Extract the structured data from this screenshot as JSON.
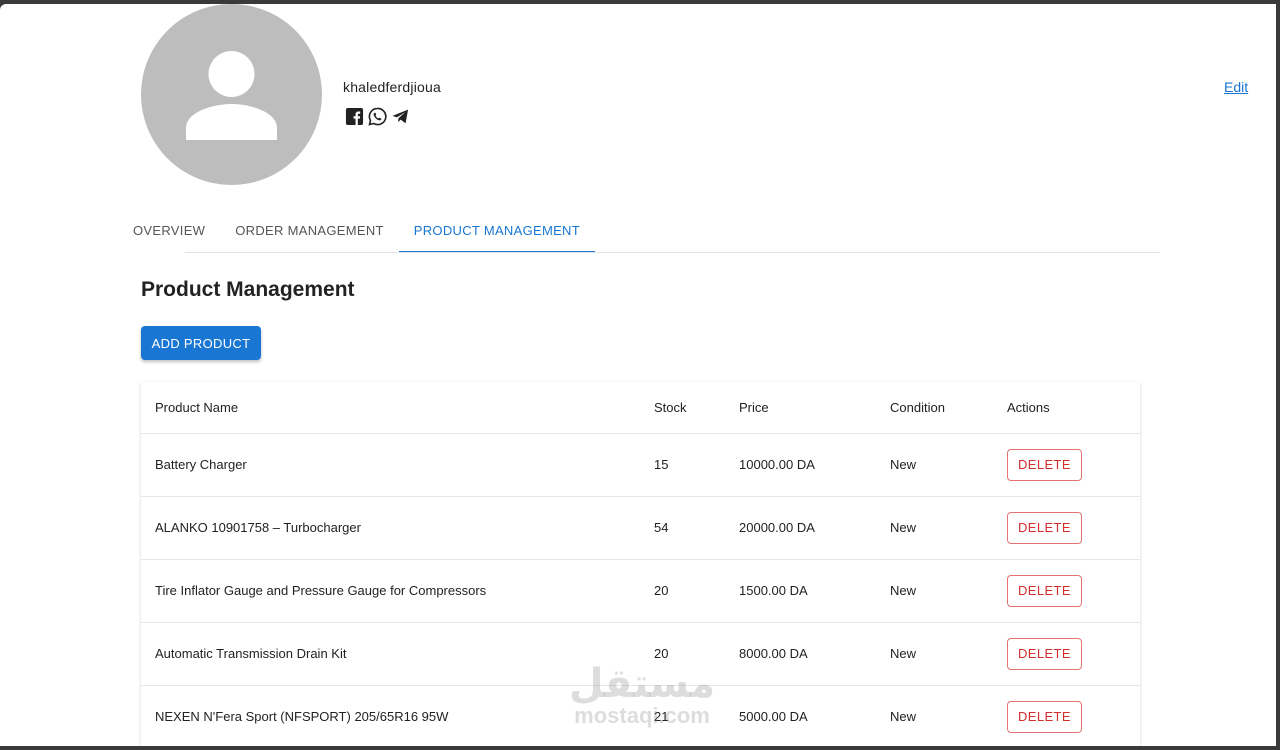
{
  "profile": {
    "username": "khaledferdjioua",
    "avatar_icon": "user-silhouette-icon",
    "socials": [
      {
        "name": "facebook-icon"
      },
      {
        "name": "whatsapp-icon"
      },
      {
        "name": "telegram-icon"
      }
    ],
    "edit_label": "Edit"
  },
  "tabs": [
    {
      "label": "OVERVIEW",
      "active": false
    },
    {
      "label": "ORDER MANAGEMENT",
      "active": false
    },
    {
      "label": "PRODUCT MANAGEMENT",
      "active": true
    }
  ],
  "section": {
    "title": "Product Management",
    "add_button_label": "ADD PRODUCT"
  },
  "table": {
    "headers": [
      "Product Name",
      "Stock",
      "Price",
      "Condition",
      "Actions"
    ],
    "delete_label": "DELETE",
    "rows": [
      {
        "name": "Battery Charger",
        "stock": "15",
        "price": "10000.00 DA",
        "condition": "New"
      },
      {
        "name": "ALANKO 10901758 – Turbocharger",
        "stock": "54",
        "price": "20000.00 DA",
        "condition": "New"
      },
      {
        "name": "Tire Inflator Gauge and Pressure Gauge for Compressors",
        "stock": "20",
        "price": "1500.00 DA",
        "condition": "New"
      },
      {
        "name": "Automatic Transmission Drain Kit",
        "stock": "20",
        "price": "8000.00 DA",
        "condition": "New"
      },
      {
        "name": "NEXEN N'Fera Sport (NFSPORT) 205/65R16 95W",
        "stock": "21",
        "price": "5000.00 DA",
        "condition": "New"
      }
    ]
  },
  "watermark": {
    "arabic": "مستقل",
    "latin": "mostaqi.com"
  },
  "colors": {
    "accent": "#1976d2",
    "danger": "#d32f2f",
    "avatar_bg": "#bdbdbd"
  }
}
